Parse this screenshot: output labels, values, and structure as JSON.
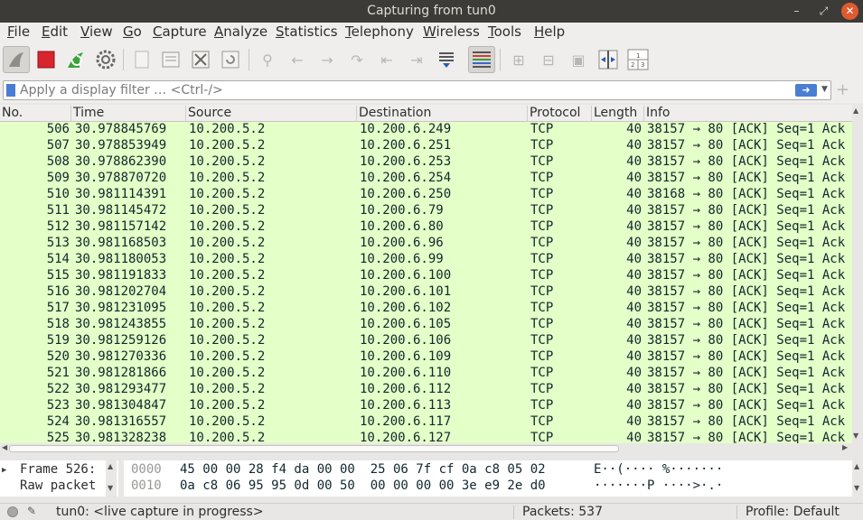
{
  "window": {
    "title": "Capturing from tun0"
  },
  "menu": [
    "File",
    "Edit",
    "View",
    "Go",
    "Capture",
    "Analyze",
    "Statistics",
    "Telephony",
    "Wireless",
    "Tools",
    "Help"
  ],
  "toolbar": {
    "icons": [
      "shark-fin-icon",
      "stop-icon",
      "restart-icon",
      "options-gear-icon",
      "open-file-icon",
      "save-file-icon",
      "close-file-icon",
      "reload-icon",
      "find-icon",
      "back-icon",
      "forward-icon",
      "goto-packet-icon",
      "first-packet-icon",
      "last-packet-icon",
      "autoscroll-icon",
      "colorize-icon",
      "zoom-in-icon",
      "zoom-out-icon",
      "normal-size-icon",
      "resize-columns-icon",
      "column-layout-icon"
    ]
  },
  "filter": {
    "placeholder": "Apply a display filter … <Ctrl-/>",
    "value": ""
  },
  "columns": [
    "No.",
    "Time",
    "Source",
    "Destination",
    "Protocol",
    "Length",
    "Info"
  ],
  "packets": [
    {
      "no": "506",
      "time": "30.978845769",
      "src": "10.200.5.2",
      "dst": "10.200.6.249",
      "proto": "TCP",
      "len": "40",
      "info": "38157 → 80 [ACK] Seq=1 Ack"
    },
    {
      "no": "507",
      "time": "30.978853949",
      "src": "10.200.5.2",
      "dst": "10.200.6.251",
      "proto": "TCP",
      "len": "40",
      "info": "38157 → 80 [ACK] Seq=1 Ack"
    },
    {
      "no": "508",
      "time": "30.978862390",
      "src": "10.200.5.2",
      "dst": "10.200.6.253",
      "proto": "TCP",
      "len": "40",
      "info": "38157 → 80 [ACK] Seq=1 Ack"
    },
    {
      "no": "509",
      "time": "30.978870720",
      "src": "10.200.5.2",
      "dst": "10.200.6.254",
      "proto": "TCP",
      "len": "40",
      "info": "38157 → 80 [ACK] Seq=1 Ack"
    },
    {
      "no": "510",
      "time": "30.981114391",
      "src": "10.200.5.2",
      "dst": "10.200.6.250",
      "proto": "TCP",
      "len": "40",
      "info": "38168 → 80 [ACK] Seq=1 Ack"
    },
    {
      "no": "511",
      "time": "30.981145472",
      "src": "10.200.5.2",
      "dst": "10.200.6.79",
      "proto": "TCP",
      "len": "40",
      "info": "38157 → 80 [ACK] Seq=1 Ack"
    },
    {
      "no": "512",
      "time": "30.981157142",
      "src": "10.200.5.2",
      "dst": "10.200.6.80",
      "proto": "TCP",
      "len": "40",
      "info": "38157 → 80 [ACK] Seq=1 Ack"
    },
    {
      "no": "513",
      "time": "30.981168503",
      "src": "10.200.5.2",
      "dst": "10.200.6.96",
      "proto": "TCP",
      "len": "40",
      "info": "38157 → 80 [ACK] Seq=1 Ack"
    },
    {
      "no": "514",
      "time": "30.981180053",
      "src": "10.200.5.2",
      "dst": "10.200.6.99",
      "proto": "TCP",
      "len": "40",
      "info": "38157 → 80 [ACK] Seq=1 Ack"
    },
    {
      "no": "515",
      "time": "30.981191833",
      "src": "10.200.5.2",
      "dst": "10.200.6.100",
      "proto": "TCP",
      "len": "40",
      "info": "38157 → 80 [ACK] Seq=1 Ack"
    },
    {
      "no": "516",
      "time": "30.981202704",
      "src": "10.200.5.2",
      "dst": "10.200.6.101",
      "proto": "TCP",
      "len": "40",
      "info": "38157 → 80 [ACK] Seq=1 Ack"
    },
    {
      "no": "517",
      "time": "30.981231095",
      "src": "10.200.5.2",
      "dst": "10.200.6.102",
      "proto": "TCP",
      "len": "40",
      "info": "38157 → 80 [ACK] Seq=1 Ack"
    },
    {
      "no": "518",
      "time": "30.981243855",
      "src": "10.200.5.2",
      "dst": "10.200.6.105",
      "proto": "TCP",
      "len": "40",
      "info": "38157 → 80 [ACK] Seq=1 Ack"
    },
    {
      "no": "519",
      "time": "30.981259126",
      "src": "10.200.5.2",
      "dst": "10.200.6.106",
      "proto": "TCP",
      "len": "40",
      "info": "38157 → 80 [ACK] Seq=1 Ack"
    },
    {
      "no": "520",
      "time": "30.981270336",
      "src": "10.200.5.2",
      "dst": "10.200.6.109",
      "proto": "TCP",
      "len": "40",
      "info": "38157 → 80 [ACK] Seq=1 Ack"
    },
    {
      "no": "521",
      "time": "30.981281866",
      "src": "10.200.5.2",
      "dst": "10.200.6.110",
      "proto": "TCP",
      "len": "40",
      "info": "38157 → 80 [ACK] Seq=1 Ack"
    },
    {
      "no": "522",
      "time": "30.981293477",
      "src": "10.200.5.2",
      "dst": "10.200.6.112",
      "proto": "TCP",
      "len": "40",
      "info": "38157 → 80 [ACK] Seq=1 Ack"
    },
    {
      "no": "523",
      "time": "30.981304847",
      "src": "10.200.5.2",
      "dst": "10.200.6.113",
      "proto": "TCP",
      "len": "40",
      "info": "38157 → 80 [ACK] Seq=1 Ack"
    },
    {
      "no": "524",
      "time": "30.981316557",
      "src": "10.200.5.2",
      "dst": "10.200.6.117",
      "proto": "TCP",
      "len": "40",
      "info": "38157 → 80 [ACK] Seq=1 Ack"
    },
    {
      "no": "525",
      "time": "30.981328238",
      "src": "10.200.5.2",
      "dst": "10.200.6.127",
      "proto": "TCP",
      "len": "40",
      "info": "38157 → 80 [ACK] Seq=1 Ack"
    }
  ],
  "details": {
    "lines": [
      "Frame 526:",
      "Raw packet"
    ]
  },
  "bytes": [
    {
      "offset": "0000",
      "hex": "45 00 00 28 f4 da 00 00  25 06 7f cf 0a c8 05 02",
      "ascii": "E··(···· %·······"
    },
    {
      "offset": "0010",
      "hex": "0a c8 06 95 95 0d 00 50  00 00 00 00 3e e9 2e d0",
      "ascii": "·······P ····>·.·"
    }
  ],
  "status": {
    "capture": "tun0: <live capture in progress>",
    "packets": "Packets: 537",
    "profile": "Profile: Default"
  },
  "colors": {
    "row_bg": "#e4ffc7",
    "titlebar": "#3c3b37",
    "close_button": "#e0592f",
    "accent": "#4a7dd4"
  }
}
